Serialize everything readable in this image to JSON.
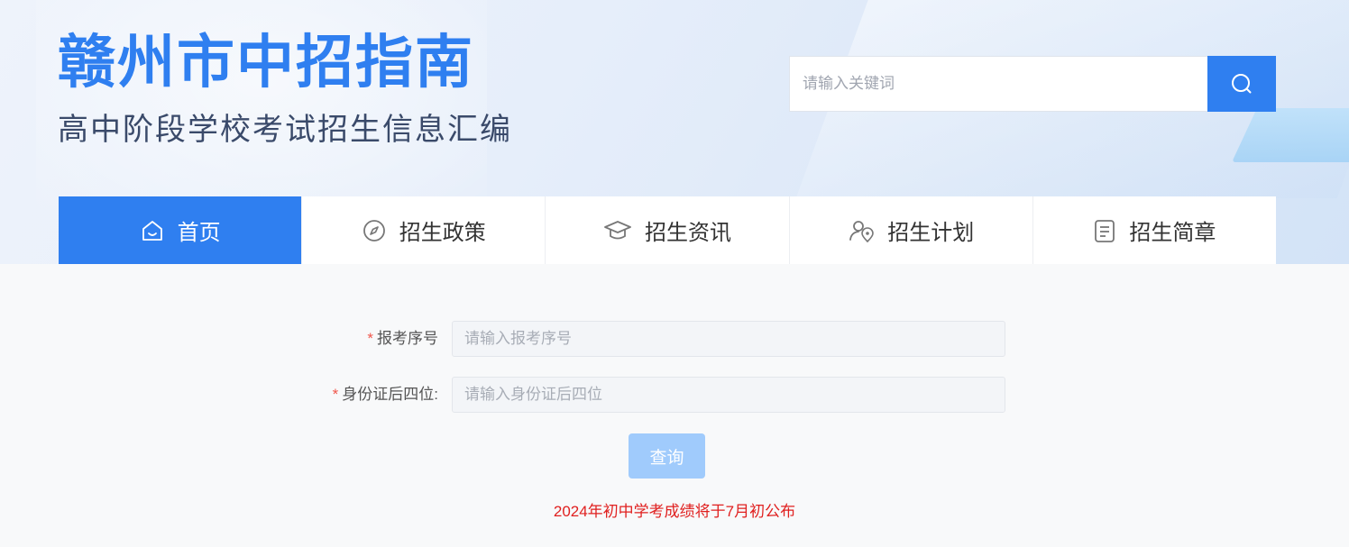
{
  "header": {
    "title": "赣州市中招指南",
    "subtitle": "高中阶段学校考试招生信息汇编"
  },
  "search": {
    "placeholder": "请输入关键词",
    "button_icon": "search-icon"
  },
  "nav": {
    "items": [
      {
        "label": "首页",
        "icon": "home-icon",
        "active": true
      },
      {
        "label": "招生政策",
        "icon": "compass-icon",
        "active": false
      },
      {
        "label": "招生资讯",
        "icon": "graduation-cap-icon",
        "active": false
      },
      {
        "label": "招生计划",
        "icon": "user-location-icon",
        "active": false
      },
      {
        "label": "招生简章",
        "icon": "document-icon",
        "active": false
      }
    ]
  },
  "form": {
    "exam_number": {
      "required_mark": "*",
      "label": "报考序号",
      "placeholder": "请输入报考序号"
    },
    "id_last4": {
      "required_mark": "*",
      "label": "身份证后四位:",
      "placeholder": "请输入身份证后四位"
    },
    "submit_label": "查询"
  },
  "notice": "2024年初中学考成绩将于7月初公布",
  "colors": {
    "accent": "#2f7ff0",
    "button_disabled": "#a0cbfc",
    "notice": "#e0201f",
    "required": "#f0564b"
  }
}
